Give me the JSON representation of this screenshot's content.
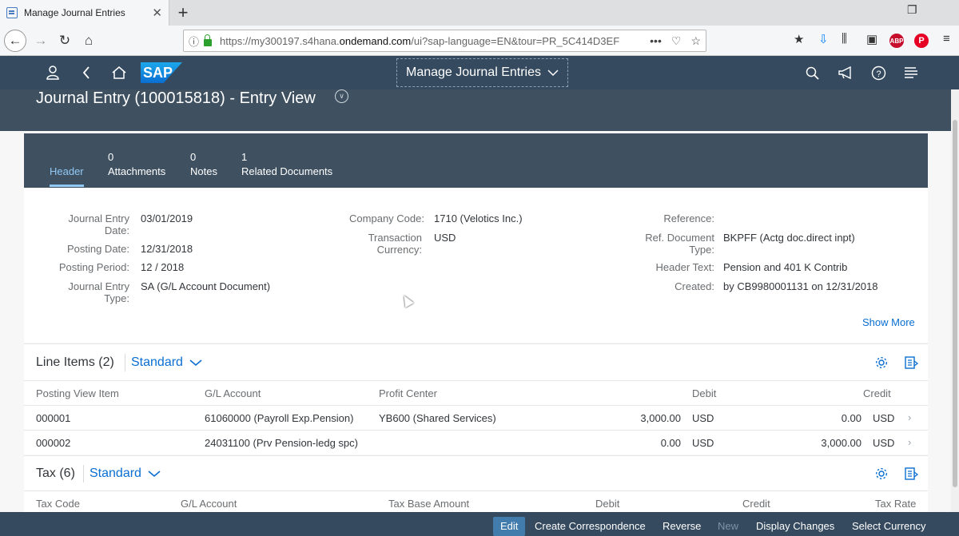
{
  "browser": {
    "tab_title": "Manage Journal Entries",
    "url_prefix": "https://my300197.s4hana.",
    "url_domain": "ondemand.com",
    "url_suffix": "/ui?sap-language=EN&tour=PR_5C414D3EF"
  },
  "shell": {
    "app_title": "Manage Journal Entries",
    "logo_text": "SAP"
  },
  "object": {
    "title": "Journal Entry (100015818) - Entry View"
  },
  "anchors": [
    {
      "count": "",
      "label": "Header"
    },
    {
      "count": "0",
      "label": "Attachments"
    },
    {
      "count": "0",
      "label": "Notes"
    },
    {
      "count": "1",
      "label": "Related Documents"
    }
  ],
  "header_fields": {
    "journal_entry_date_label_1": "Journal Entry",
    "journal_entry_date_label_2": "Date:",
    "journal_entry_date": "03/01/2019",
    "posting_date_label": "Posting Date:",
    "posting_date": "12/31/2018",
    "posting_period_label": "Posting Period:",
    "posting_period": "12 / 2018",
    "journal_entry_type_label_1": "Journal Entry",
    "journal_entry_type_label_2": "Type:",
    "journal_entry_type": "SA (G/L Account Document)",
    "company_code_label": "Company Code:",
    "company_code": "1710 (Velotics Inc.)",
    "transaction_currency_label_1": "Transaction",
    "transaction_currency_label_2": "Currency:",
    "transaction_currency": "USD",
    "reference_label": "Reference:",
    "ref_doc_type_label_1": "Ref. Document",
    "ref_doc_type_label_2": "Type:",
    "ref_doc_type": "BKPFF (Actg doc.direct inpt)",
    "header_text_label": "Header Text:",
    "header_text": "Pension and 401 K Contrib",
    "created_label": "Created:",
    "created": "by CB9980001131 on 12/31/2018",
    "show_more": "Show More"
  },
  "line_items": {
    "title": "Line Items (2)",
    "variant": "Standard",
    "columns": [
      "Posting View Item",
      "G/L Account",
      "Profit Center",
      "Debit",
      "Credit"
    ],
    "rows": [
      {
        "item": "000001",
        "gl": "61060000 (Payroll Exp.Pension)",
        "profit_center": "YB600 (Shared Services)",
        "debit": "3,000.00",
        "debit_cur": "USD",
        "credit": "0.00",
        "credit_cur": "USD"
      },
      {
        "item": "000002",
        "gl": "24031100 (Prv Pension-ledg spc)",
        "profit_center": "",
        "debit": "0.00",
        "debit_cur": "USD",
        "credit": "3,000.00",
        "credit_cur": "USD"
      }
    ]
  },
  "tax": {
    "title": "Tax (6)",
    "variant": "Standard",
    "columns": [
      "Tax Code",
      "G/L Account",
      "Tax Base Amount",
      "Debit",
      "Credit",
      "Tax Rate"
    ]
  },
  "footer": {
    "edit": "Edit",
    "create_correspondence": "Create Correspondence",
    "reverse": "Reverse",
    "new": "New",
    "display_changes": "Display Changes",
    "select_currency": "Select Currency"
  }
}
